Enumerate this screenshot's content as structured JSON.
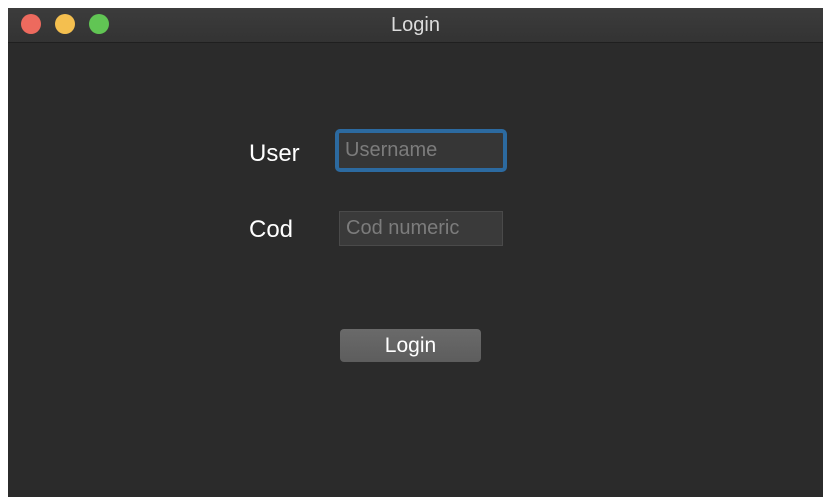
{
  "window": {
    "title": "Login",
    "controls": [
      "close-icon",
      "minimize-icon",
      "zoom-icon"
    ],
    "colors": {
      "background": "#2b2b2b",
      "focus_ring": "#2c6aa0",
      "close": "#ed6a5e",
      "minimize": "#f4bf4f",
      "zoom": "#61c554"
    }
  },
  "form": {
    "user_label": "User",
    "user_placeholder": "Username",
    "user_value": "",
    "code_label": "Cod",
    "code_placeholder": "Cod numeric",
    "code_value": "",
    "submit_label": "Login"
  }
}
